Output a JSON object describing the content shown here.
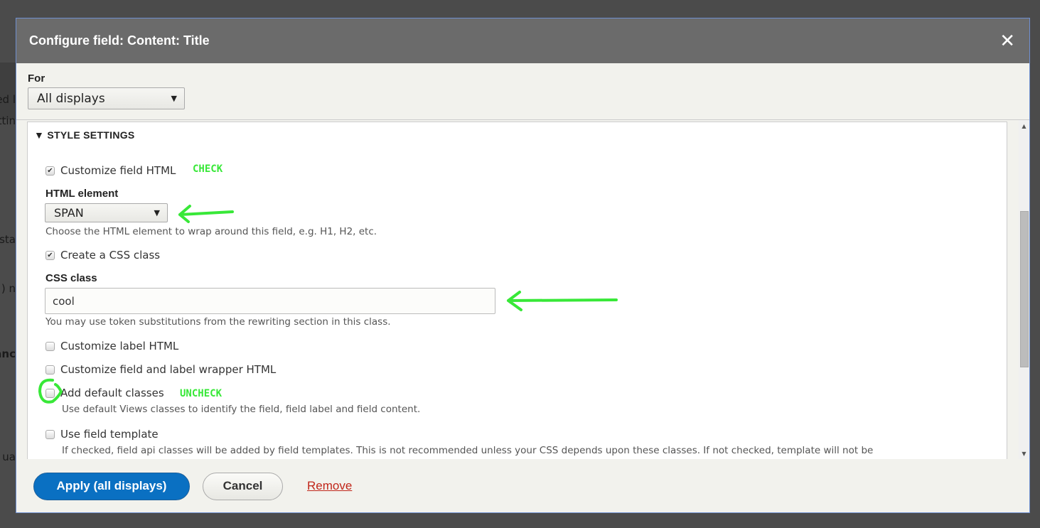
{
  "background_fragments": [
    "ed l",
    "ttin",
    "sta",
    "n (",
    "anc",
    "ua"
  ],
  "dialog": {
    "title": "Configure field: Content: Title",
    "close_icon": "close-icon",
    "for_label": "For",
    "for_select": "All displays",
    "style_settings": {
      "legend": "STYLE SETTINGS",
      "customize_field_html": {
        "label": "Customize field HTML",
        "checked": true,
        "annotation": "CHECK"
      },
      "html_element": {
        "label": "HTML element",
        "value": "SPAN",
        "description": "Choose the HTML element to wrap around this field, e.g. H1, H2, etc."
      },
      "create_css_class": {
        "label": "Create a CSS class",
        "checked": true
      },
      "css_class": {
        "label": "CSS class",
        "value": "cool",
        "description": "You may use token substitutions from the rewriting section in this class."
      },
      "customize_label_html": {
        "label": "Customize label HTML",
        "checked": false
      },
      "customize_wrapper_html": {
        "label": "Customize field and label wrapper HTML",
        "checked": false
      },
      "add_default_classes": {
        "label": "Add default classes",
        "checked": false,
        "annotation": "UNCHECK",
        "description": "Use default Views classes to identify the field, field label and field content."
      },
      "use_field_template": {
        "label": "Use field template",
        "checked": false,
        "description": "If checked, field api classes will be added by field templates. This is not recommended unless your CSS depends upon these classes. If not checked, template will not be"
      }
    },
    "footer": {
      "apply": "Apply (all displays)",
      "cancel": "Cancel",
      "remove": "Remove"
    }
  },
  "colors": {
    "annotation": "#38e838",
    "primary": "#0a70c2",
    "header": "#6b6b6b",
    "link": "#c1261a"
  }
}
